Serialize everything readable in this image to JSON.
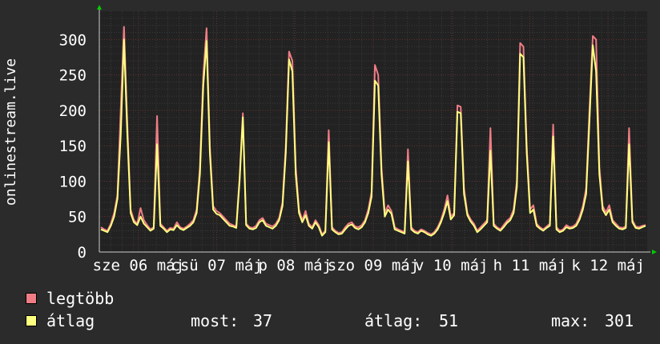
{
  "chart_data": {
    "type": "area",
    "ylabel": "onlinestream.live",
    "ylim": [
      0,
      340
    ],
    "yticks": [
      0,
      50,
      100,
      150,
      200,
      250,
      300
    ],
    "xticks": [
      "sze 06 máj",
      "csü 07 máj",
      "p 08 máj",
      "szo 09 máj",
      "v 10 máj",
      "h 11 máj",
      "k 12 máj"
    ],
    "grid": true,
    "series": [
      {
        "name": "legtöbb",
        "color": "#f07d85",
        "values": [
          35,
          32,
          30,
          40,
          55,
          80,
          200,
          318,
          180,
          60,
          45,
          40,
          62,
          45,
          38,
          32,
          35,
          192,
          40,
          35,
          30,
          34,
          33,
          42,
          35,
          33,
          36,
          40,
          45,
          60,
          120,
          250,
          316,
          150,
          65,
          58,
          55,
          50,
          45,
          40,
          38,
          36,
          105,
          196,
          40,
          35,
          34,
          37,
          45,
          48,
          40,
          38,
          36,
          40,
          48,
          70,
          150,
          283,
          270,
          120,
          60,
          45,
          58,
          40,
          35,
          45,
          38,
          25,
          30,
          172,
          35,
          30,
          27,
          28,
          35,
          40,
          42,
          36,
          35,
          38,
          45,
          60,
          85,
          264,
          250,
          120,
          55,
          66,
          58,
          35,
          32,
          30,
          28,
          145,
          35,
          30,
          28,
          32,
          30,
          27,
          25,
          28,
          35,
          45,
          60,
          80,
          50,
          55,
          207,
          205,
          90,
          55,
          46,
          40,
          30,
          35,
          40,
          45,
          175,
          40,
          35,
          32,
          38,
          44,
          48,
          60,
          100,
          295,
          290,
          150,
          60,
          66,
          40,
          35,
          32,
          36,
          40,
          180,
          35,
          30,
          32,
          38,
          35,
          36,
          40,
          50,
          65,
          90,
          200,
          305,
          300,
          120,
          65,
          56,
          66,
          45,
          40,
          35,
          34,
          36,
          175,
          45,
          36,
          35,
          37,
          38
        ]
      },
      {
        "name": "átlag",
        "color": "#ffff80",
        "values": [
          32,
          30,
          28,
          37,
          50,
          75,
          165,
          300,
          165,
          55,
          42,
          38,
          50,
          40,
          35,
          30,
          33,
          152,
          37,
          33,
          28,
          32,
          31,
          38,
          33,
          31,
          34,
          37,
          42,
          55,
          110,
          235,
          298,
          140,
          60,
          54,
          52,
          47,
          42,
          37,
          36,
          34,
          100,
          190,
          38,
          33,
          32,
          34,
          42,
          45,
          37,
          35,
          33,
          37,
          45,
          65,
          140,
          272,
          255,
          110,
          55,
          42,
          52,
          37,
          33,
          42,
          35,
          23,
          28,
          155,
          32,
          28,
          25,
          26,
          32,
          37,
          39,
          34,
          32,
          35,
          42,
          55,
          78,
          242,
          235,
          110,
          50,
          60,
          54,
          32,
          30,
          28,
          26,
          128,
          32,
          28,
          26,
          30,
          28,
          25,
          23,
          26,
          32,
          42,
          55,
          72,
          46,
          52,
          198,
          196,
          82,
          52,
          43,
          37,
          28,
          32,
          37,
          42,
          143,
          37,
          33,
          30,
          35,
          41,
          45,
          55,
          92,
          280,
          275,
          140,
          55,
          60,
          37,
          33,
          30,
          34,
          37,
          163,
          32,
          28,
          30,
          35,
          33,
          34,
          37,
          46,
          60,
          82,
          185,
          292,
          255,
          110,
          60,
          52,
          60,
          42,
          37,
          33,
          32,
          34,
          152,
          42,
          34,
          33,
          35,
          37
        ]
      }
    ],
    "stats": {
      "most_label": "most:",
      "most": "37",
      "atlag_label": "átlag:",
      "atlag": "51",
      "max_label": "max:",
      "max": "301"
    },
    "colors": {
      "background": "#2b2b2b",
      "plot_bg": "#222222",
      "grid_minor": "#3a3a3a",
      "grid_major": "#663333",
      "axis": "#cccccc",
      "arrow": "#00cc00"
    }
  }
}
